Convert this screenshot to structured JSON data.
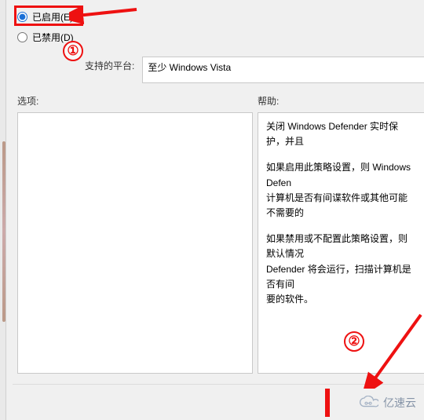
{
  "radios": {
    "enabled_label": "已启用(E)",
    "disabled_label": "已禁用(D)",
    "selected": "enabled"
  },
  "platform": {
    "label": "支持的平台:",
    "value": "至少 Windows Vista"
  },
  "columns": {
    "options_label": "选项:",
    "help_label": "帮助:"
  },
  "help": {
    "p1": "关闭 Windows Defender 实时保护，并且",
    "p2a": "如果启用此策略设置，则 Windows Defen",
    "p2b": "计算机是否有间谍软件或其他可能不需要的",
    "p3a": "如果禁用或不配置此策略设置，则默认情况",
    "p3b": "Defender 将会运行，扫描计算机是否有间",
    "p3c": "要的软件。"
  },
  "annotations": {
    "num1": "①",
    "num2": "②"
  },
  "watermark": {
    "text": "亿速云"
  },
  "colors": {
    "highlight": "#e11",
    "accent": "#1a6fd6"
  }
}
